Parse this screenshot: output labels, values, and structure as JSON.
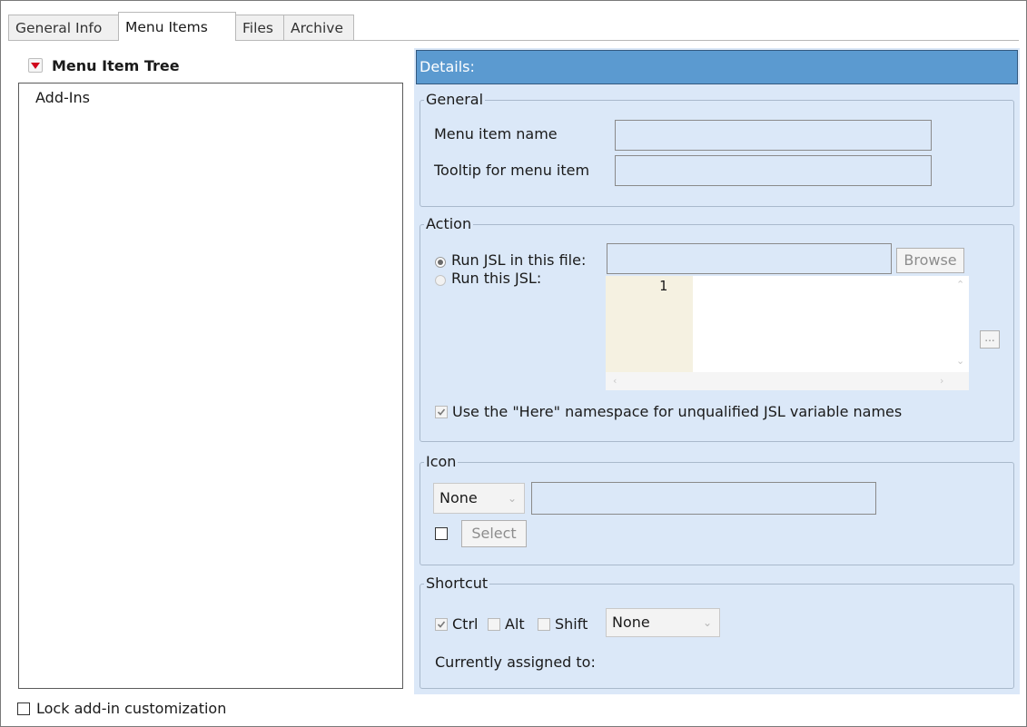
{
  "tabs": [
    {
      "label": "General Info",
      "active": false
    },
    {
      "label": "Menu Items",
      "active": true
    },
    {
      "label": "Files",
      "active": false
    },
    {
      "label": "Archive",
      "active": false
    }
  ],
  "tree": {
    "title": "Menu Item Tree",
    "items": [
      "Add-Ins"
    ]
  },
  "lock": {
    "label": "Lock add-in customization",
    "checked": false
  },
  "details": {
    "header": "Details:",
    "general": {
      "legend": "General",
      "menu_item_name_label": "Menu item name",
      "menu_item_name_value": "",
      "tooltip_label": "Tooltip for menu item",
      "tooltip_value": ""
    },
    "action": {
      "legend": "Action",
      "run_file_label": "Run JSL in this file:",
      "run_file_value": "",
      "browse_label": "Browse",
      "run_jsl_label": "Run this JSL:",
      "line_number": "1",
      "ellipsis_label": "...",
      "here_namespace_label": "Use the \"Here\" namespace for unqualified JSL variable names",
      "here_namespace_checked": true
    },
    "icon": {
      "legend": "Icon",
      "type_value": "None",
      "path_value": "",
      "select_label": "Select"
    },
    "shortcut": {
      "legend": "Shortcut",
      "ctrl_label": "Ctrl",
      "ctrl_checked": true,
      "alt_label": "Alt",
      "shift_label": "Shift",
      "key_value": "None",
      "assigned_label": "Currently assigned to:"
    }
  },
  "colors": {
    "details_bar": "#5b9ad0",
    "panel_bg": "#dbe8f8",
    "collapse_triangle": "#d0021b"
  }
}
